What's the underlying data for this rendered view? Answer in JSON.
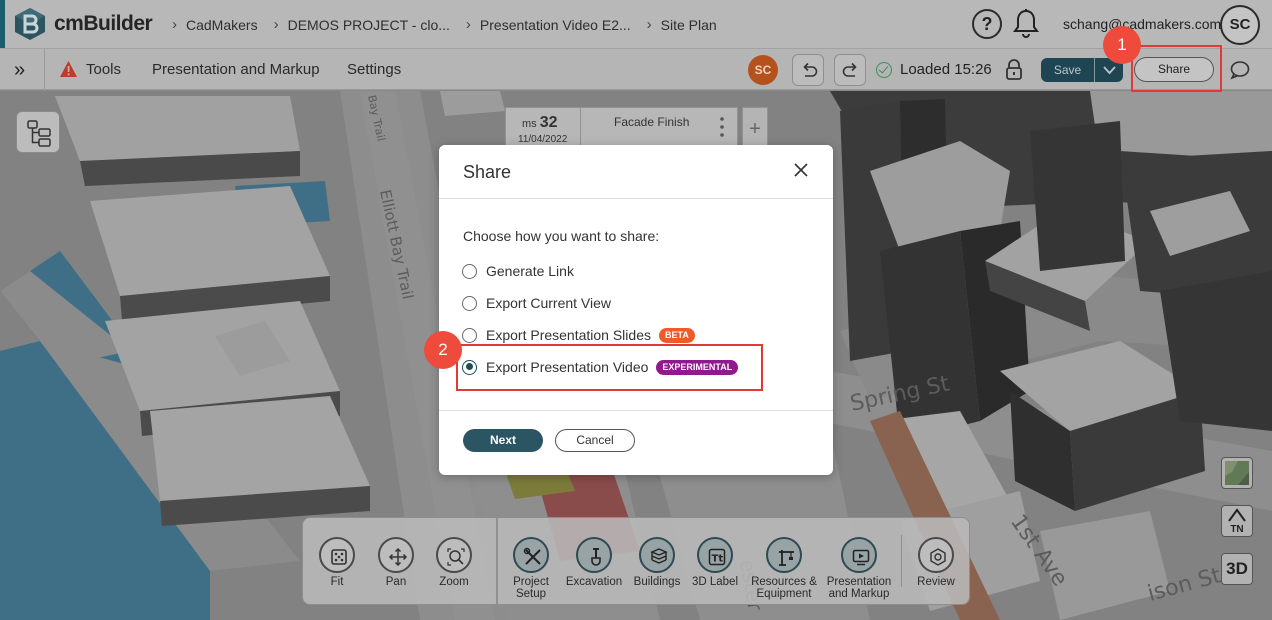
{
  "app": {
    "brand": "cmBuilder",
    "breadcrumb": [
      "CadMakers",
      "DEMOS PROJECT - clo...",
      "Presentation Video E2...",
      "Site Plan"
    ],
    "help_label": "?",
    "user_email": "schang@cadmakers.com",
    "user_initials": "SC"
  },
  "toolbar": {
    "menus": [
      "Tools",
      "Presentation and Markup",
      "Settings"
    ],
    "collaborator_initials": "SC",
    "status_text": "Loaded 15:26",
    "save_label": "Save",
    "share_label": "Share"
  },
  "timeline": {
    "ms_prefix": "ms",
    "ms_number": "32",
    "date": "11/04/2022",
    "title": "Facade Finish",
    "add_label": "+"
  },
  "viewer": {
    "north_label": "TN",
    "view_mode": "3D"
  },
  "dock": {
    "tools": [
      "Fit",
      "Pan",
      "Zoom",
      "Project Setup",
      "Excavation",
      "Buildings",
      "3D Label",
      "Resources & Equipment",
      "Presentation and Markup",
      "Review"
    ]
  },
  "dialog": {
    "title": "Share",
    "prompt": "Choose how you want to share:",
    "options": [
      {
        "label": "Generate Link",
        "tag": ""
      },
      {
        "label": "Export Current View",
        "tag": ""
      },
      {
        "label": "Export Presentation Slides",
        "tag": "BETA"
      },
      {
        "label": "Export Presentation Video",
        "tag": "EXPERIMENTAL"
      }
    ],
    "selected_option": "Export Presentation Video",
    "next_label": "Next",
    "cancel_label": "Cancel"
  },
  "annotations": {
    "step1": "1",
    "step2": "2"
  },
  "colors": {
    "accent": "#1f4552",
    "highlight": "#e03a3a",
    "step_badge": "#ee4b3d",
    "beta_tag": "#f05a28",
    "experimental_tag": "#8e1a8e"
  }
}
